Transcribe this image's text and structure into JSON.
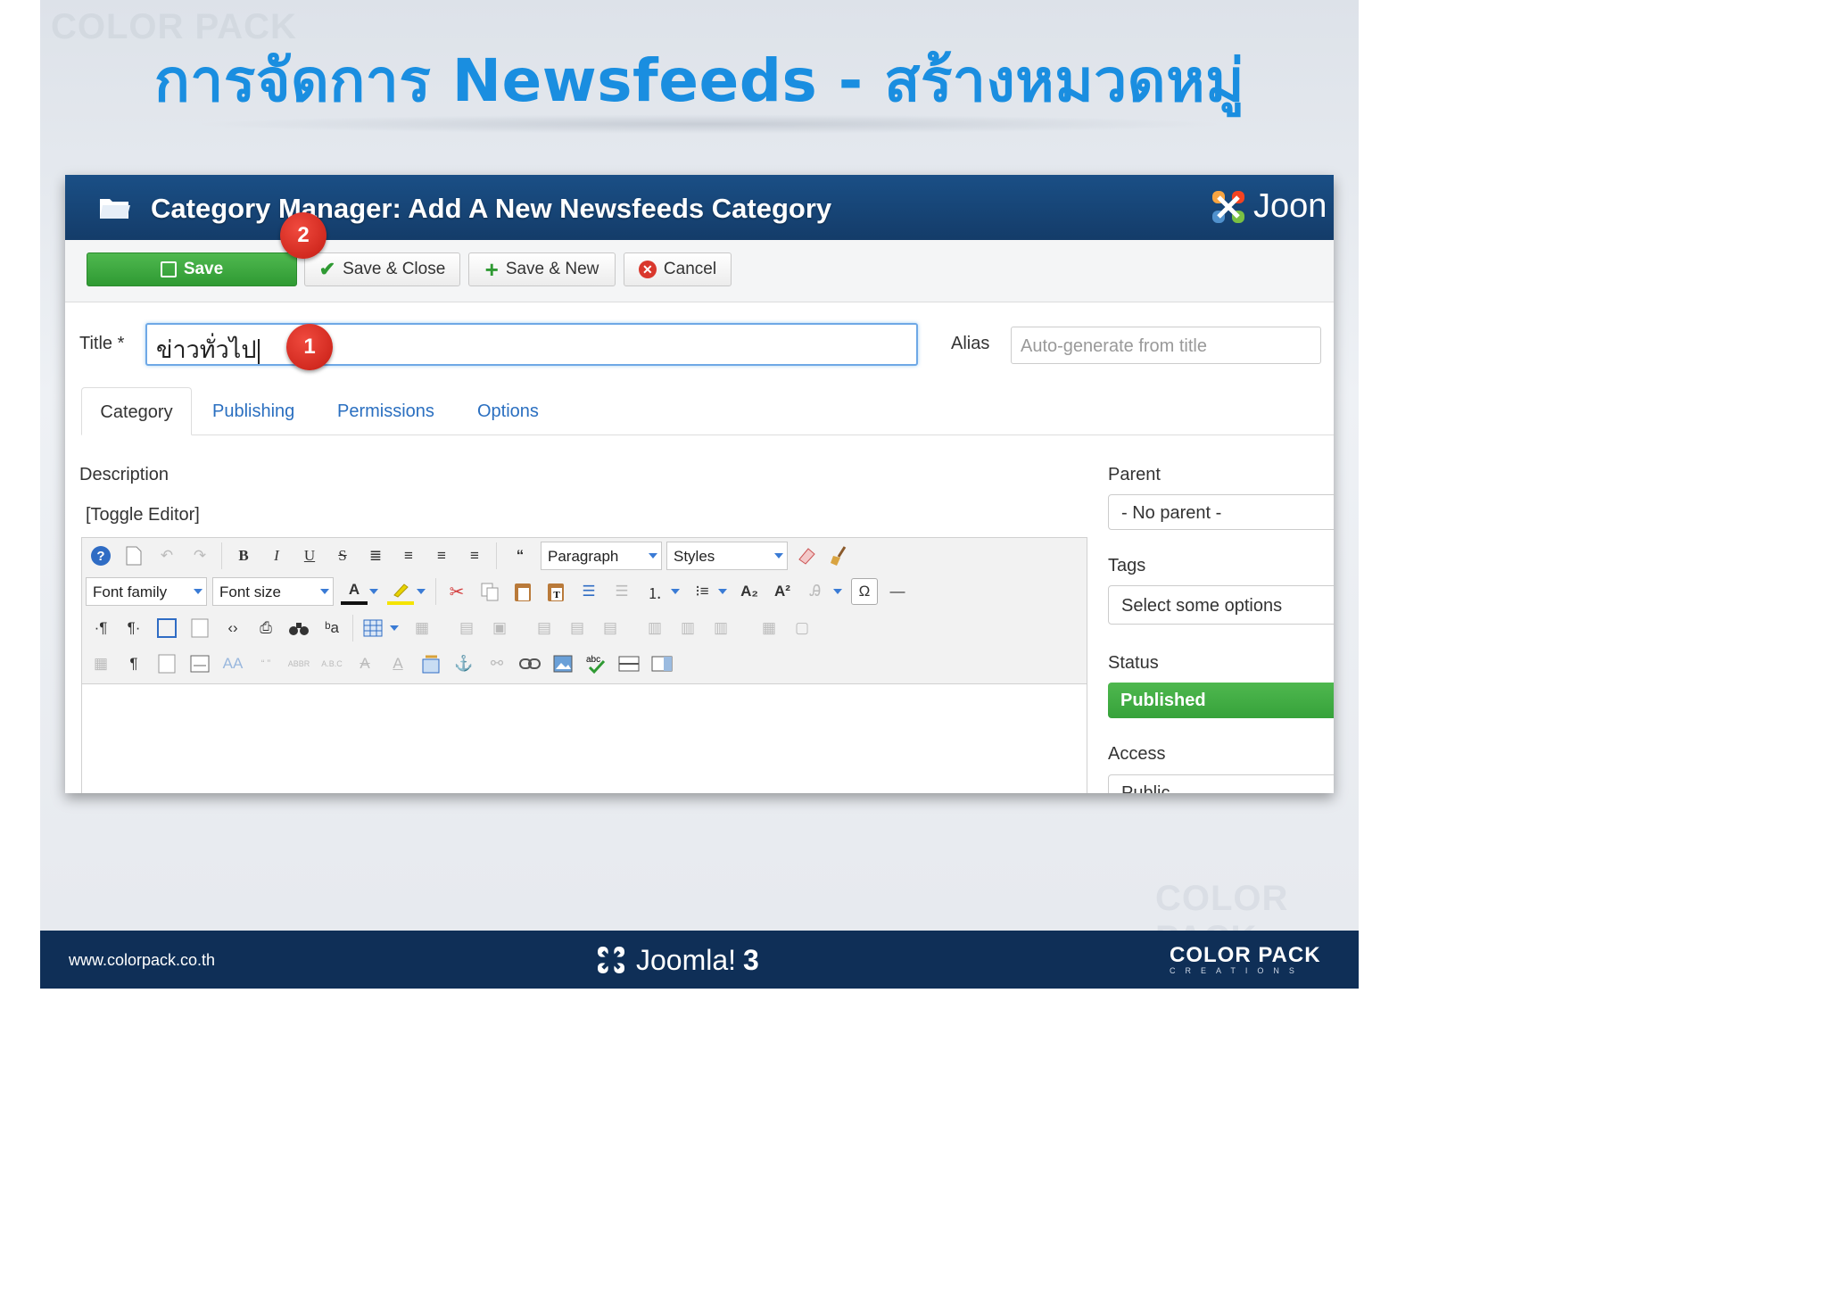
{
  "slide": {
    "title": "การจัดการ Newsfeeds - สร้างหมวดหมู่",
    "watermark": "COLOR PACK"
  },
  "window": {
    "title": "Category Manager: Add A New Newsfeeds Category",
    "logo_text": "Joon",
    "toolbar": {
      "save": "Save",
      "save_close": "Save & Close",
      "save_new": "Save & New",
      "cancel": "Cancel"
    },
    "badges": {
      "first": "1",
      "second": "2"
    },
    "fields": {
      "title_label": "Title *",
      "title_value": "ข่าวทั่วไป",
      "alias_label": "Alias",
      "alias_placeholder": "Auto-generate from title"
    },
    "tabs": [
      {
        "label": "Category",
        "active": true
      },
      {
        "label": "Publishing",
        "active": false
      },
      {
        "label": "Permissions",
        "active": false
      },
      {
        "label": "Options",
        "active": false
      }
    ],
    "description_label": "Description",
    "toggle_editor": "[Toggle Editor]",
    "editor": {
      "format_select": "Paragraph",
      "styles_select": "Styles",
      "font_family": "Font family",
      "font_size": "Font size"
    },
    "sidebar": {
      "parent_label": "Parent",
      "parent_value": "- No parent -",
      "tags_label": "Tags",
      "tags_placeholder": "Select some options",
      "status_label": "Status",
      "status_value": "Published",
      "access_label": "Access",
      "access_value": "Public"
    }
  },
  "footer": {
    "url": "www.colorpack.co.th",
    "product": "Joomla!",
    "version": "3",
    "brand": "COLOR PACK",
    "brand_sub": "CREATIONS"
  },
  "colors": {
    "title_blue": "#1a8ee0",
    "header_navy": "#143c69",
    "save_green": "#2f9a33",
    "badge_red": "#d22a20",
    "footer_navy": "#0f2f57"
  }
}
